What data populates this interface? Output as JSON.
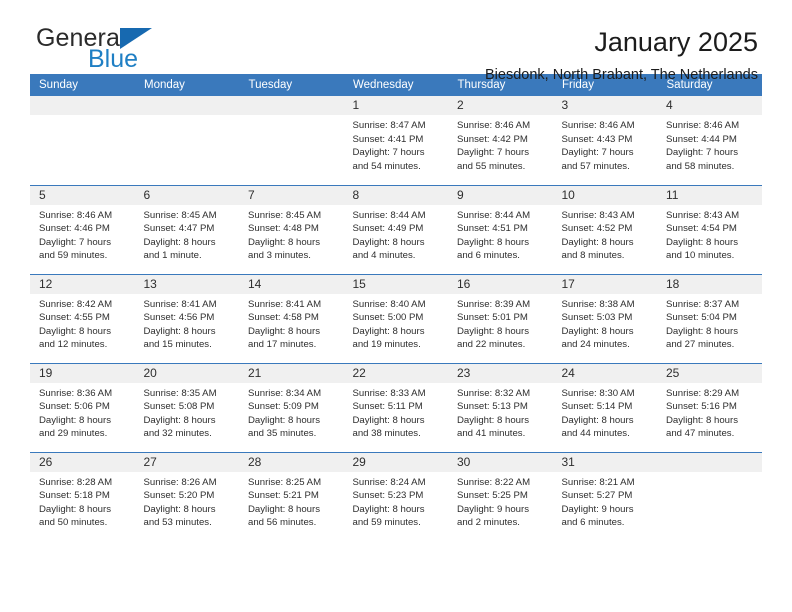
{
  "logo": {
    "general": "General",
    "blue": "Blue",
    "triangle_color": "#1769b0",
    "blue_color": "#1f7fc4"
  },
  "header": {
    "title": "January 2025",
    "subtitle": "Biesdonk, North Brabant, The Netherlands"
  },
  "theme": {
    "header_bg": "#3a79bc",
    "daynum_bg": "#f0f0f0",
    "text": "#2e2e2e"
  },
  "weekdays": [
    "Sunday",
    "Monday",
    "Tuesday",
    "Wednesday",
    "Thursday",
    "Friday",
    "Saturday"
  ],
  "weeks": [
    [
      {
        "day": "",
        "lines": []
      },
      {
        "day": "",
        "lines": []
      },
      {
        "day": "",
        "lines": []
      },
      {
        "day": "1",
        "lines": [
          "Sunrise: 8:47 AM",
          "Sunset: 4:41 PM",
          "Daylight: 7 hours",
          "and 54 minutes."
        ]
      },
      {
        "day": "2",
        "lines": [
          "Sunrise: 8:46 AM",
          "Sunset: 4:42 PM",
          "Daylight: 7 hours",
          "and 55 minutes."
        ]
      },
      {
        "day": "3",
        "lines": [
          "Sunrise: 8:46 AM",
          "Sunset: 4:43 PM",
          "Daylight: 7 hours",
          "and 57 minutes."
        ]
      },
      {
        "day": "4",
        "lines": [
          "Sunrise: 8:46 AM",
          "Sunset: 4:44 PM",
          "Daylight: 7 hours",
          "and 58 minutes."
        ]
      }
    ],
    [
      {
        "day": "5",
        "lines": [
          "Sunrise: 8:46 AM",
          "Sunset: 4:46 PM",
          "Daylight: 7 hours",
          "and 59 minutes."
        ]
      },
      {
        "day": "6",
        "lines": [
          "Sunrise: 8:45 AM",
          "Sunset: 4:47 PM",
          "Daylight: 8 hours",
          "and 1 minute."
        ]
      },
      {
        "day": "7",
        "lines": [
          "Sunrise: 8:45 AM",
          "Sunset: 4:48 PM",
          "Daylight: 8 hours",
          "and 3 minutes."
        ]
      },
      {
        "day": "8",
        "lines": [
          "Sunrise: 8:44 AM",
          "Sunset: 4:49 PM",
          "Daylight: 8 hours",
          "and 4 minutes."
        ]
      },
      {
        "day": "9",
        "lines": [
          "Sunrise: 8:44 AM",
          "Sunset: 4:51 PM",
          "Daylight: 8 hours",
          "and 6 minutes."
        ]
      },
      {
        "day": "10",
        "lines": [
          "Sunrise: 8:43 AM",
          "Sunset: 4:52 PM",
          "Daylight: 8 hours",
          "and 8 minutes."
        ]
      },
      {
        "day": "11",
        "lines": [
          "Sunrise: 8:43 AM",
          "Sunset: 4:54 PM",
          "Daylight: 8 hours",
          "and 10 minutes."
        ]
      }
    ],
    [
      {
        "day": "12",
        "lines": [
          "Sunrise: 8:42 AM",
          "Sunset: 4:55 PM",
          "Daylight: 8 hours",
          "and 12 minutes."
        ]
      },
      {
        "day": "13",
        "lines": [
          "Sunrise: 8:41 AM",
          "Sunset: 4:56 PM",
          "Daylight: 8 hours",
          "and 15 minutes."
        ]
      },
      {
        "day": "14",
        "lines": [
          "Sunrise: 8:41 AM",
          "Sunset: 4:58 PM",
          "Daylight: 8 hours",
          "and 17 minutes."
        ]
      },
      {
        "day": "15",
        "lines": [
          "Sunrise: 8:40 AM",
          "Sunset: 5:00 PM",
          "Daylight: 8 hours",
          "and 19 minutes."
        ]
      },
      {
        "day": "16",
        "lines": [
          "Sunrise: 8:39 AM",
          "Sunset: 5:01 PM",
          "Daylight: 8 hours",
          "and 22 minutes."
        ]
      },
      {
        "day": "17",
        "lines": [
          "Sunrise: 8:38 AM",
          "Sunset: 5:03 PM",
          "Daylight: 8 hours",
          "and 24 minutes."
        ]
      },
      {
        "day": "18",
        "lines": [
          "Sunrise: 8:37 AM",
          "Sunset: 5:04 PM",
          "Daylight: 8 hours",
          "and 27 minutes."
        ]
      }
    ],
    [
      {
        "day": "19",
        "lines": [
          "Sunrise: 8:36 AM",
          "Sunset: 5:06 PM",
          "Daylight: 8 hours",
          "and 29 minutes."
        ]
      },
      {
        "day": "20",
        "lines": [
          "Sunrise: 8:35 AM",
          "Sunset: 5:08 PM",
          "Daylight: 8 hours",
          "and 32 minutes."
        ]
      },
      {
        "day": "21",
        "lines": [
          "Sunrise: 8:34 AM",
          "Sunset: 5:09 PM",
          "Daylight: 8 hours",
          "and 35 minutes."
        ]
      },
      {
        "day": "22",
        "lines": [
          "Sunrise: 8:33 AM",
          "Sunset: 5:11 PM",
          "Daylight: 8 hours",
          "and 38 minutes."
        ]
      },
      {
        "day": "23",
        "lines": [
          "Sunrise: 8:32 AM",
          "Sunset: 5:13 PM",
          "Daylight: 8 hours",
          "and 41 minutes."
        ]
      },
      {
        "day": "24",
        "lines": [
          "Sunrise: 8:30 AM",
          "Sunset: 5:14 PM",
          "Daylight: 8 hours",
          "and 44 minutes."
        ]
      },
      {
        "day": "25",
        "lines": [
          "Sunrise: 8:29 AM",
          "Sunset: 5:16 PM",
          "Daylight: 8 hours",
          "and 47 minutes."
        ]
      }
    ],
    [
      {
        "day": "26",
        "lines": [
          "Sunrise: 8:28 AM",
          "Sunset: 5:18 PM",
          "Daylight: 8 hours",
          "and 50 minutes."
        ]
      },
      {
        "day": "27",
        "lines": [
          "Sunrise: 8:26 AM",
          "Sunset: 5:20 PM",
          "Daylight: 8 hours",
          "and 53 minutes."
        ]
      },
      {
        "day": "28",
        "lines": [
          "Sunrise: 8:25 AM",
          "Sunset: 5:21 PM",
          "Daylight: 8 hours",
          "and 56 minutes."
        ]
      },
      {
        "day": "29",
        "lines": [
          "Sunrise: 8:24 AM",
          "Sunset: 5:23 PM",
          "Daylight: 8 hours",
          "and 59 minutes."
        ]
      },
      {
        "day": "30",
        "lines": [
          "Sunrise: 8:22 AM",
          "Sunset: 5:25 PM",
          "Daylight: 9 hours",
          "and 2 minutes."
        ]
      },
      {
        "day": "31",
        "lines": [
          "Sunrise: 8:21 AM",
          "Sunset: 5:27 PM",
          "Daylight: 9 hours",
          "and 6 minutes."
        ]
      },
      {
        "day": "",
        "lines": []
      }
    ]
  ]
}
